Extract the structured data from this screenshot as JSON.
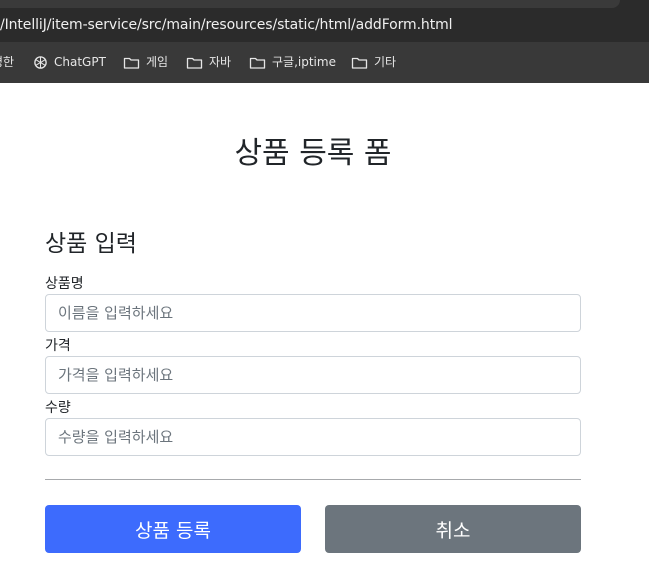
{
  "browser": {
    "url": "/IntelliJ/item-service/src/main/resources/static/html/addForm.html",
    "bookmarks": [
      {
        "label": "명한",
        "icon": "none"
      },
      {
        "label": "ChatGPT",
        "icon": "chatgpt-icon"
      },
      {
        "label": "게임",
        "icon": "folder-icon"
      },
      {
        "label": "자바",
        "icon": "folder-icon"
      },
      {
        "label": "구글,iptime",
        "icon": "folder-icon"
      },
      {
        "label": "기타",
        "icon": "folder-icon"
      }
    ]
  },
  "page": {
    "title": "상품 등록 폼",
    "section_title": "상품 입력"
  },
  "form": {
    "name": {
      "label": "상품명",
      "placeholder": "이름을 입력하세요",
      "value": ""
    },
    "price": {
      "label": "가격",
      "placeholder": "가격을 입력하세요",
      "value": ""
    },
    "quantity": {
      "label": "수량",
      "placeholder": "수량을 입력하세요",
      "value": ""
    }
  },
  "buttons": {
    "submit": "상품 등록",
    "cancel": "취소"
  },
  "colors": {
    "primary": "#3d6bfd",
    "secondary": "#6c757d",
    "chrome_dark": "#2b2b2b",
    "bookmark_bar": "#393939"
  }
}
